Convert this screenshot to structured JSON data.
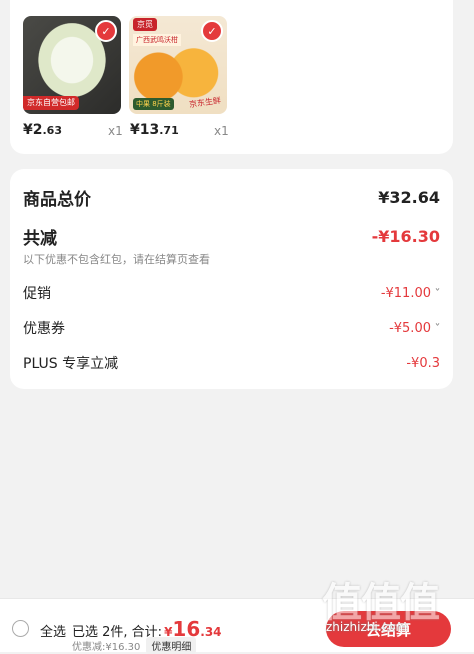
{
  "products": [
    {
      "tag": "京东自营包邮",
      "price_main": "¥2",
      "price_cents": ".63",
      "qty": "x1"
    },
    {
      "brand": "京觅",
      "title": "广西武鸣沃柑",
      "weight": "中果 8斤装",
      "stamp": "京东生鲜",
      "price_main": "¥13",
      "price_cents": ".71",
      "qty": "x1"
    }
  ],
  "summary": {
    "total_label": "商品总价",
    "total_value": "¥32.64",
    "reduce_label": "共减",
    "reduce_value": "-¥16.30",
    "hint": "以下优惠不包含红包，请在结算页查看",
    "lines": [
      {
        "label": "促销",
        "value": "-¥11.00",
        "chevron": "˅"
      },
      {
        "label": "优惠券",
        "value": "-¥5.00",
        "chevron": "˅"
      },
      {
        "label": "PLUS 专享立减",
        "value": "-¥0.3"
      }
    ]
  },
  "footer": {
    "select_all": "全选",
    "selected_text": "已选 2件, 合计:",
    "sum_yen": "¥",
    "sum_main": "16",
    "sum_cents": ".34",
    "discount_text": "优惠减:¥16.30",
    "detail_button": "优惠明细",
    "checkout_button": "去结算"
  },
  "watermark": {
    "text": "值值值",
    "url": "zhizhizhi.com"
  },
  "colors": {
    "accent": "#e4393c",
    "background": "#f2f2f2"
  }
}
